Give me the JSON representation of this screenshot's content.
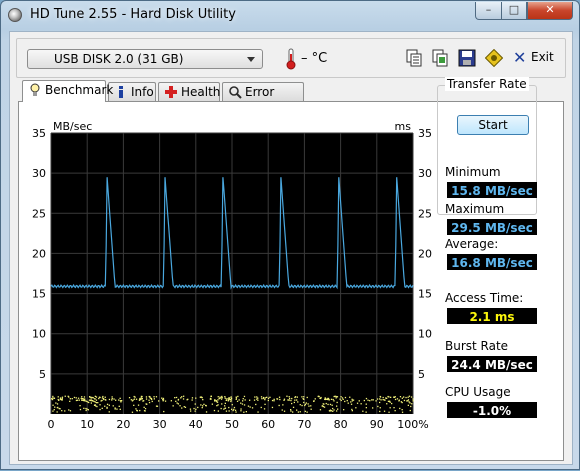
{
  "window": {
    "title": "HD Tune 2.55 - Hard Disk Utility",
    "controls": {
      "minimize": "–",
      "maximize": "□",
      "close": "✕"
    }
  },
  "toolbar": {
    "drive": "USB DISK 2.0 (31 GB)",
    "temperature": "– °C",
    "icons": [
      "copy-text-icon",
      "copy-screenshot-icon",
      "save-icon",
      "options-icon"
    ],
    "exit_label": "Exit"
  },
  "tabs": [
    {
      "label": "Benchmark",
      "icon": "lightbulb-icon",
      "active": true
    },
    {
      "label": "Info",
      "icon": "info-icon",
      "active": false
    },
    {
      "label": "Health",
      "icon": "health-cross-icon",
      "active": false
    },
    {
      "label": "Error Scan",
      "icon": "magnifier-icon",
      "active": false
    }
  ],
  "benchmark": {
    "start_label": "Start",
    "transfer_rate": {
      "legend": "Transfer Rate",
      "minimum_label": "Minimum",
      "minimum": "15.8 MB/sec",
      "maximum_label": "Maximum",
      "maximum": "29.5 MB/sec",
      "average_label": "Average:",
      "average": "16.8 MB/sec"
    },
    "access_time_label": "Access Time:",
    "access_time": "2.1 ms",
    "burst_rate_label": "Burst Rate",
    "burst_rate": "24.4 MB/sec",
    "cpu_usage_label": "CPU Usage",
    "cpu_usage": "-1.0%"
  },
  "colors": {
    "plot_bg": "#000000",
    "grid": "#3a3a3a",
    "transfer_line": "#4aa8df",
    "access_dots": "#f2f27a",
    "readout_blue": "#5fb7ef",
    "readout_yellow": "#fbf50d"
  },
  "chart_data": {
    "type": "line",
    "y_left_label": "MB/sec",
    "y_right_label": "ms",
    "ylim": [
      0,
      35
    ],
    "yticks": [
      5,
      10,
      15,
      20,
      25,
      30,
      35
    ],
    "xlim": [
      0,
      100
    ],
    "xticks": [
      "0",
      "10",
      "20",
      "30",
      "40",
      "50",
      "60",
      "70",
      "80",
      "90",
      "100%"
    ],
    "grid": true,
    "series": [
      {
        "kind": "transfer-rate",
        "baseline": 15.9,
        "spike_peak": 29.5,
        "spike_positions": [
          15.5,
          31.5,
          47.5,
          63.5,
          79.5,
          95.5
        ]
      },
      {
        "kind": "access-time",
        "values_ms_range": [
          0.3,
          2.4
        ]
      }
    ]
  }
}
